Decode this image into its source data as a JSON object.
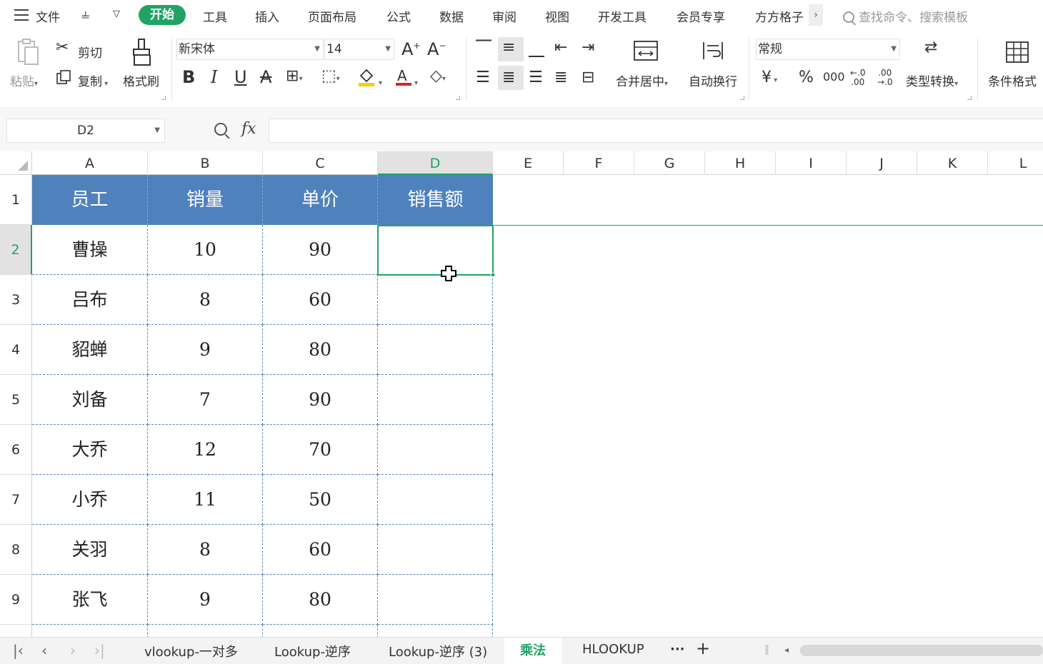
{
  "menu": {
    "file": "文件",
    "tabs": [
      "工具",
      "插入",
      "页面布局",
      "公式",
      "数据",
      "审阅",
      "视图",
      "开发工具",
      "会员专享",
      "方方格子"
    ],
    "active_tab": "开始",
    "search_placeholder": "查找命令、搜索模板"
  },
  "ribbon": {
    "paste": "粘贴",
    "cut": "剪切",
    "copy": "复制",
    "format_painter": "格式刷",
    "font_name": "新宋体",
    "font_size": "14",
    "merge_center": "合并居中",
    "wrap_text": "自动换行",
    "number_format": "常规",
    "type_convert": "类型转换",
    "cond_format": "条件格式",
    "currency": "¥",
    "percent": "%",
    "thousands": "000",
    "inc_decimal": "←.0\n.00",
    "dec_decimal": ".00\n→.0"
  },
  "formula_bar": {
    "name_box": "D2",
    "fx": "fx",
    "value": ""
  },
  "grid": {
    "columns": [
      "A",
      "B",
      "C",
      "D",
      "E",
      "F",
      "G",
      "H",
      "I",
      "J",
      "K",
      "L"
    ],
    "selected_column": "D",
    "rows": [
      "1",
      "2",
      "3",
      "4",
      "5",
      "6",
      "7",
      "8",
      "9"
    ],
    "selected_row": "2",
    "headers": [
      "员工",
      "销量",
      "单价",
      "销售额"
    ],
    "data": [
      [
        "曹操",
        "10",
        "90",
        ""
      ],
      [
        "吕布",
        "8",
        "60",
        ""
      ],
      [
        "貂蝉",
        "9",
        "80",
        ""
      ],
      [
        "刘备",
        "7",
        "90",
        ""
      ],
      [
        "大乔",
        "12",
        "70",
        ""
      ],
      [
        "小乔",
        "11",
        "50",
        ""
      ],
      [
        "关羽",
        "8",
        "60",
        ""
      ],
      [
        "张飞",
        "9",
        "80",
        ""
      ]
    ]
  },
  "sheets": {
    "tabs": [
      "vlookup-一对多",
      "Lookup-逆序",
      "Lookup-逆序 (3)",
      "乘法",
      "HLOOKUP"
    ],
    "active": "乘法",
    "more": "···",
    "add": "+"
  },
  "colors": {
    "accent": "#21a366",
    "header_fill": "#4f81bd",
    "dashed_border": "#5b85b8"
  }
}
